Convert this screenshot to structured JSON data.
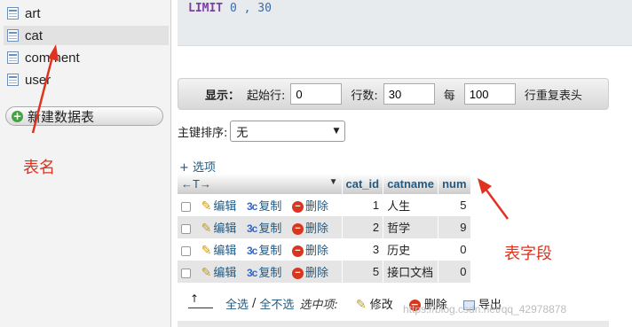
{
  "sidebar": {
    "tables": [
      "art",
      "cat",
      "comment",
      "user"
    ],
    "new_table_label": "新建数据表"
  },
  "annotations": {
    "table_name": "表名",
    "table_field": "表字段"
  },
  "sql": {
    "keyword": "LIMIT",
    "value": "0 , 30"
  },
  "navigation": {
    "show_label": "显示：",
    "start_label": "起始行:",
    "start_value": "0",
    "rows_label": "行数:",
    "rows_value": "30",
    "every_label": "每",
    "every_value": "100",
    "repeat_label": "行重复表头"
  },
  "sort": {
    "label": "主键排序:",
    "selected": "无"
  },
  "options_link": "+ 选项",
  "table": {
    "arrows": "←T→",
    "columns": [
      "cat_id",
      "catname",
      "num"
    ],
    "action_labels": {
      "edit": "编辑",
      "copy": "复制",
      "delete": "删除"
    },
    "rows": [
      {
        "cat_id": "1",
        "catname": "人生",
        "num": "5"
      },
      {
        "cat_id": "2",
        "catname": "哲学",
        "num": "9"
      },
      {
        "cat_id": "3",
        "catname": "历史",
        "num": "0"
      },
      {
        "cat_id": "5",
        "catname": "接口文档",
        "num": "0"
      }
    ]
  },
  "bulk": {
    "select_all": "全选",
    "separator": "/",
    "deselect_all": "全不选",
    "selected_label": "选中项:",
    "edit": "修改",
    "delete": "删除",
    "export": "导出"
  },
  "watermark": "https://blog.csdn.net/qq_42978878"
}
